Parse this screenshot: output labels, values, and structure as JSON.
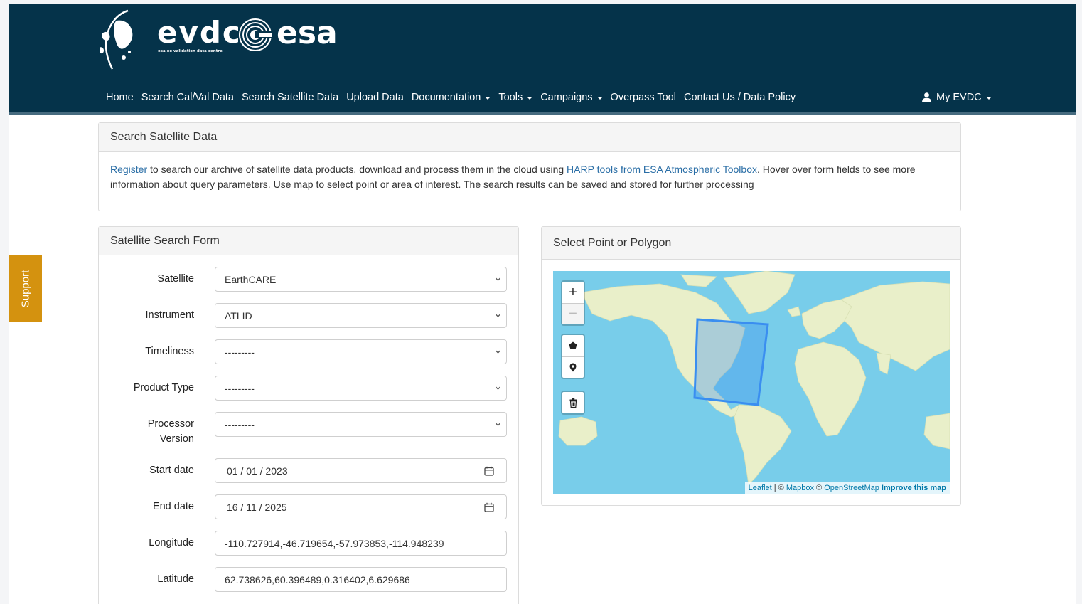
{
  "logo": {
    "evdc": "evdc",
    "evdc_sub": "esa eo validation data centre",
    "esa": "esa"
  },
  "nav": {
    "items": [
      {
        "label": "Home",
        "dropdown": false
      },
      {
        "label": "Search Cal/Val Data",
        "dropdown": false
      },
      {
        "label": "Search Satellite Data",
        "dropdown": false
      },
      {
        "label": "Upload Data",
        "dropdown": false
      },
      {
        "label": "Documentation",
        "dropdown": true
      },
      {
        "label": "Tools",
        "dropdown": true
      },
      {
        "label": "Campaigns",
        "dropdown": true
      },
      {
        "label": "Overpass Tool",
        "dropdown": false
      },
      {
        "label": "Contact Us / Data Policy",
        "dropdown": false
      }
    ],
    "account": "My EVDC",
    "account_icon": "user-icon"
  },
  "support": {
    "label": "Support"
  },
  "intro": {
    "title": "Search Satellite Data",
    "register_link": "Register",
    "text_1": " to search our archive of satellite data products, download and process them in the cloud using ",
    "harp_link": "HARP tools from ESA Atmospheric Toolbox",
    "text_2": ". Hover over form fields to see more information about query parameters. Use map to select point or area of interest. The search results can be saved and stored for further processing"
  },
  "form": {
    "title": "Satellite Search Form",
    "satellite": {
      "label": "Satellite",
      "value": "EarthCARE"
    },
    "instrument": {
      "label": "Instrument",
      "value": "ATLID"
    },
    "timeliness": {
      "label": "Timeliness",
      "value": "---------"
    },
    "product_type": {
      "label": "Product Type",
      "value": "---------"
    },
    "processor_version": {
      "label": "Processor Version",
      "value": "---------"
    },
    "start_date": {
      "label": "Start date",
      "value": "01 / 01 / 2023"
    },
    "end_date": {
      "label": "End date",
      "value": "16 / 11 / 2025"
    },
    "longitude": {
      "label": "Longitude",
      "value": "-110.727914,-46.719654,-57.973853,-114.948239"
    },
    "latitude": {
      "label": "Latitude",
      "value": "62.738626,60.396489,0.316402,6.629686"
    }
  },
  "map": {
    "title": "Select Point or Polygon",
    "zoom_in": "+",
    "zoom_out": "−",
    "attribution": {
      "leaflet": "Leaflet",
      "sep": " | © ",
      "mapbox": "Mapbox",
      "osm_prefix": " © ",
      "osm": "OpenStreetMap",
      "improve": "Improve this map"
    },
    "colors": {
      "water": "#78cdea",
      "land": "#e9efc9",
      "polygon": "#3a8ef0"
    }
  },
  "colors": {
    "header": "#05334a",
    "support": "#d4920f",
    "link": "#2a6ea6"
  }
}
